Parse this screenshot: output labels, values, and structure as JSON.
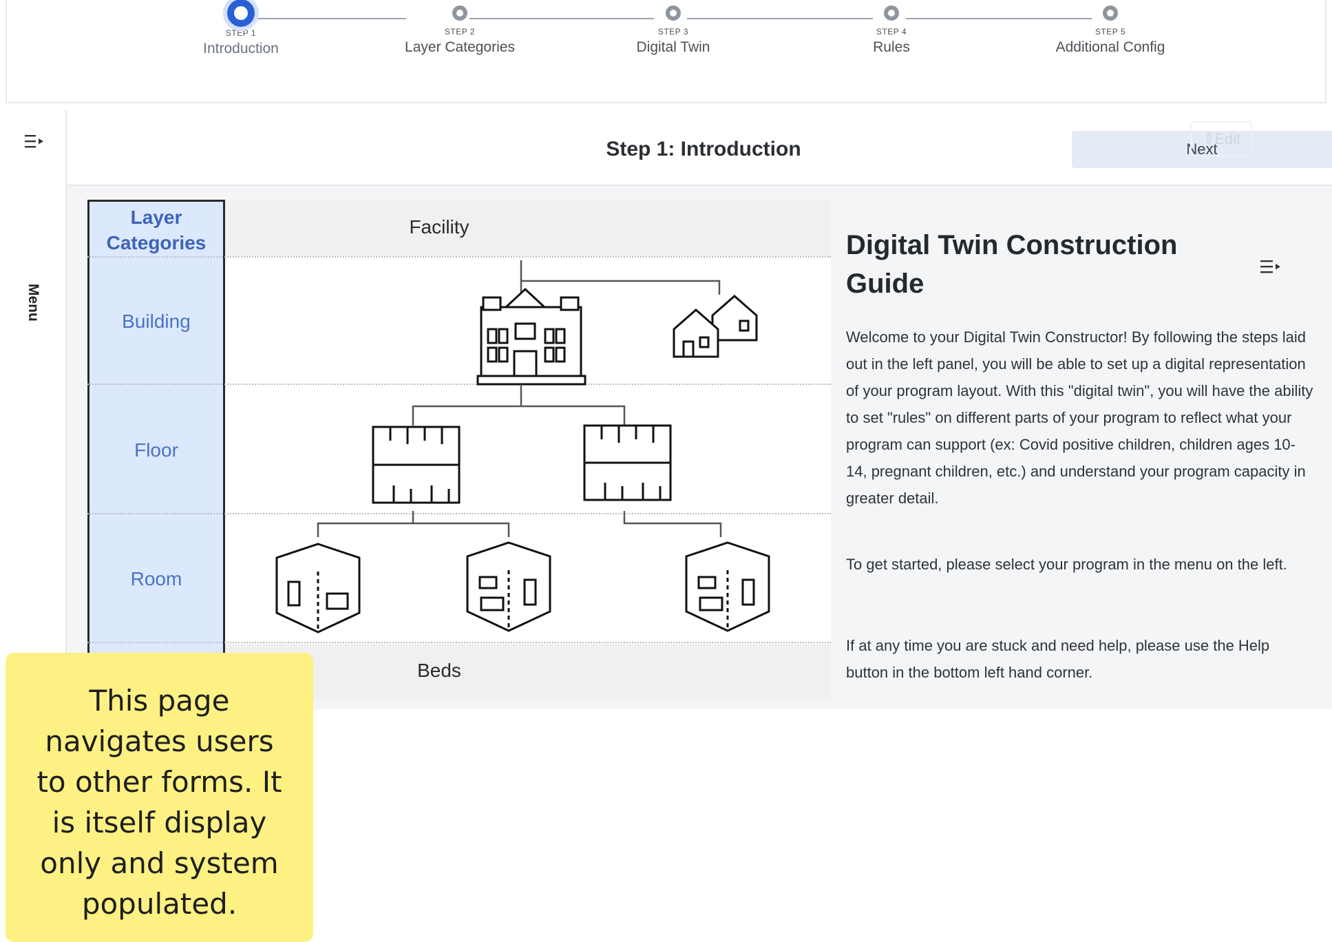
{
  "stepper": {
    "steps": [
      {
        "num": "STEP 1",
        "name": "Introduction",
        "state": "active"
      },
      {
        "num": "STEP 2",
        "name": "Layer Categories",
        "state": "pending"
      },
      {
        "num": "STEP 3",
        "name": "Digital Twin",
        "state": "pending"
      },
      {
        "num": "STEP 4",
        "name": "Rules",
        "state": "pending"
      },
      {
        "num": "STEP 5",
        "name": "Additional Config",
        "state": "pending"
      }
    ]
  },
  "rail": {
    "label": "Menu",
    "icon": "menu-collapse-icon"
  },
  "header": {
    "title": "Step 1: Introduction",
    "next_label": "Next",
    "edit_label": "Edit"
  },
  "diagram": {
    "categories_header": "Layer Categories",
    "categories": [
      "Building",
      "Floor",
      "Room"
    ],
    "levels": {
      "top": "Facility",
      "bottom": "Beds"
    }
  },
  "guide": {
    "title": "Digital Twin Construction Guide",
    "paragraphs": [
      "Welcome to your Digital Twin Constructor! By following the steps laid out in the left panel, you will be able to set up a digital representation of your program layout. With this \"digital twin\", you will have the ability to set \"rules\" on different parts of your program to reflect what your program can support (ex: Covid positive children, children ages 10-14, pregnant children, etc.) and understand your program capacity in greater detail.",
      "To get started, please select your program in the menu on the left.",
      "If at any time you are stuck and need help, please use the Help button in the bottom left hand corner."
    ]
  },
  "sticky_note": "This page navigates users to other forms. It is itself display only and system populated.",
  "colors": {
    "accent": "#2a5fd6",
    "category_bg": "#dce8fb",
    "category_text": "#4a73c7",
    "sticky": "#fdf183"
  }
}
